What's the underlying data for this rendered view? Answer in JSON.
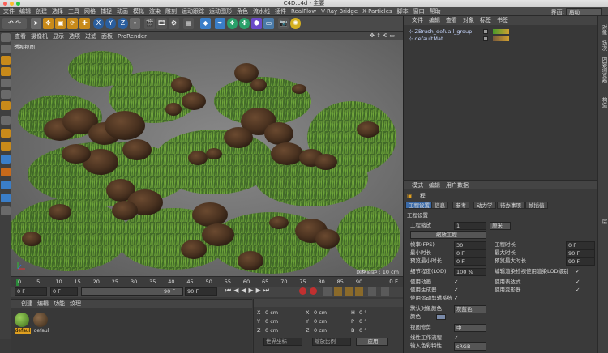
{
  "window": {
    "title": "C4D.c4d - 主要"
  },
  "menubar": {
    "items": [
      "文件",
      "编辑",
      "创建",
      "选择",
      "工具",
      "网格",
      "捕捉",
      "动画",
      "模拟",
      "渲染",
      "雕刻",
      "运动跟踪",
      "运动图形",
      "角色",
      "流水线",
      "插件",
      "RealFlow",
      "V-Ray Bridge",
      "X-Particles",
      "脚本",
      "窗口",
      "帮助"
    ],
    "layout_label": "界面:",
    "layout_value": "启动"
  },
  "toolbar": {
    "axis_buttons": [
      "X",
      "Y",
      "Z"
    ]
  },
  "viewport": {
    "menu": [
      "查看",
      "摄像机",
      "显示",
      "选项",
      "过滤",
      "面板",
      "ProRender"
    ],
    "label": "透视视图",
    "grid_info": "网格间距 : 10 cm"
  },
  "timeline": {
    "ticks": [
      "0",
      "5",
      "10",
      "15",
      "20",
      "25",
      "30",
      "35",
      "40",
      "45",
      "50",
      "55",
      "60",
      "65",
      "70",
      "75",
      "80",
      "85",
      "90"
    ],
    "frame_end_label": "0 F"
  },
  "transport": {
    "current": "0 F",
    "min": "0 F",
    "max_a": "90 F",
    "max_b": "90 F"
  },
  "material_manager": {
    "menu": [
      "创建",
      "编辑",
      "功能",
      "纹理"
    ],
    "materials": [
      "defaul",
      "defaul"
    ]
  },
  "coordinates": {
    "rows": [
      {
        "a": "X",
        "v1": "0 cm",
        "b": "X",
        "v2": "0 cm",
        "c": "H",
        "v3": "0 °"
      },
      {
        "a": "Y",
        "v1": "0 cm",
        "b": "Y",
        "v2": "0 cm",
        "c": "P",
        "v3": "0 °"
      },
      {
        "a": "Z",
        "v1": "0 cm",
        "b": "Z",
        "v2": "0 cm",
        "c": "B",
        "v3": "0 °"
      }
    ],
    "world_label": "世界坐标",
    "scale_label": "缩放比例",
    "apply": "应用"
  },
  "object_manager": {
    "menu": [
      "文件",
      "编辑",
      "查看",
      "对象",
      "标签",
      "书签"
    ],
    "objects": [
      "ZBrush_defuall_group",
      "defaultMat"
    ]
  },
  "attribute_manager": {
    "menu": [
      "模式",
      "编辑",
      "用户数据"
    ],
    "header": "工程",
    "tabs": [
      "工程设置",
      "信息",
      "参考",
      "动力学",
      "待办事项",
      "帧插值"
    ],
    "section": "工程设置",
    "scale_label": "工程缩放",
    "scale_value": "1",
    "scale_unit": "厘米",
    "scale_button": "缩放工程...",
    "fps_label": "帧率(FPS)",
    "fps_value": "30",
    "project_time_label": "工程时长",
    "project_time_value": "0 F",
    "min_time_label": "最小时长",
    "min_time_value": "0 F",
    "max_time_label": "最大时长",
    "max_time_value": "90 F",
    "preview_min_label": "预览最小时长",
    "preview_min_value": "0 F",
    "preview_max_label": "预览最大时长",
    "preview_max_value": "90 F",
    "lod_label": "细节程度(LOD)",
    "lod_value": "100 %",
    "render_lod_label": "编辑渲染检视使用渲染LOD级别",
    "use_anim_label": "使用动画",
    "use_expr_label": "使用表达式",
    "use_gen_label": "使用生成器",
    "use_deform_label": "使用变形器",
    "use_motion_label": "使用运动剪辑系统",
    "default_color_label": "默认对象颜色",
    "default_color_value": "灰蓝色",
    "color_label": "颜色",
    "clip_label": "视图修剪",
    "clip_value": "中",
    "linear_label": "线性工作流程",
    "input_color_label": "输入色彩特性",
    "input_color_value": "sRGB"
  },
  "right_strip": {
    "tabs": [
      "对象",
      "场次",
      "内容浏览器",
      "构造",
      "层"
    ]
  }
}
